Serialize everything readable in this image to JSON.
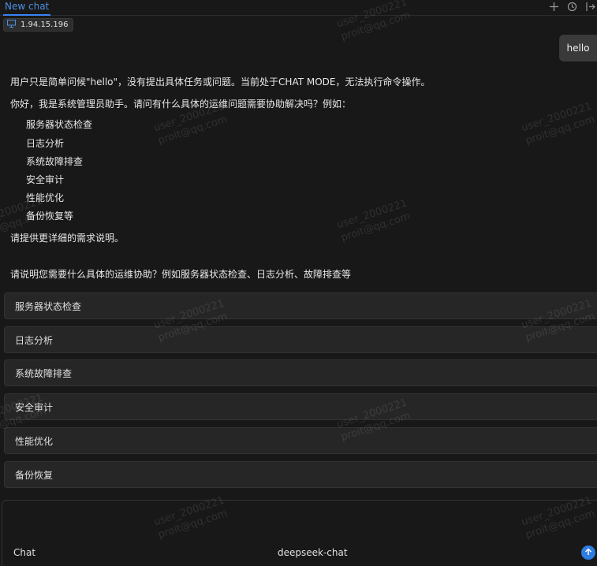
{
  "tab": {
    "label": "New chat"
  },
  "toolbar": {
    "new_icon": "plus-icon",
    "history_icon": "history-icon",
    "collapse_icon": "panel-collapse-icon"
  },
  "host": {
    "ip": "1.94.15.196",
    "icon": "monitor-icon"
  },
  "user_message": "hello",
  "assistant": {
    "intro": "用户只是简单问候\"hello\"，没有提出具体任务或问题。当前处于CHAT MODE，无法执行命令操作。",
    "greeting": "你好，我是系统管理员助手。请问有什么具体的运维问题需要协助解决吗？例如：",
    "examples": [
      "服务器状态检查",
      "日志分析",
      "系统故障排查",
      "安全审计",
      "性能优化",
      "备份恢复等"
    ],
    "closing": "请提供更详细的需求说明。",
    "prompt": "请说明您需要什么具体的运维协助？例如服务器状态检查、日志分析、故障排查等"
  },
  "options": [
    "服务器状态检查",
    "日志分析",
    "系统故障排查",
    "安全审计",
    "性能优化",
    "备份恢复"
  ],
  "composer": {
    "mode": "Chat",
    "model": "deepseek-chat",
    "send_icon": "arrow-up-icon"
  },
  "watermark": {
    "user": "user_2000221",
    "email": "proit@qq.com"
  },
  "colors": {
    "accent": "#3b82f6",
    "background": "#181818",
    "option_bg": "#262626"
  }
}
